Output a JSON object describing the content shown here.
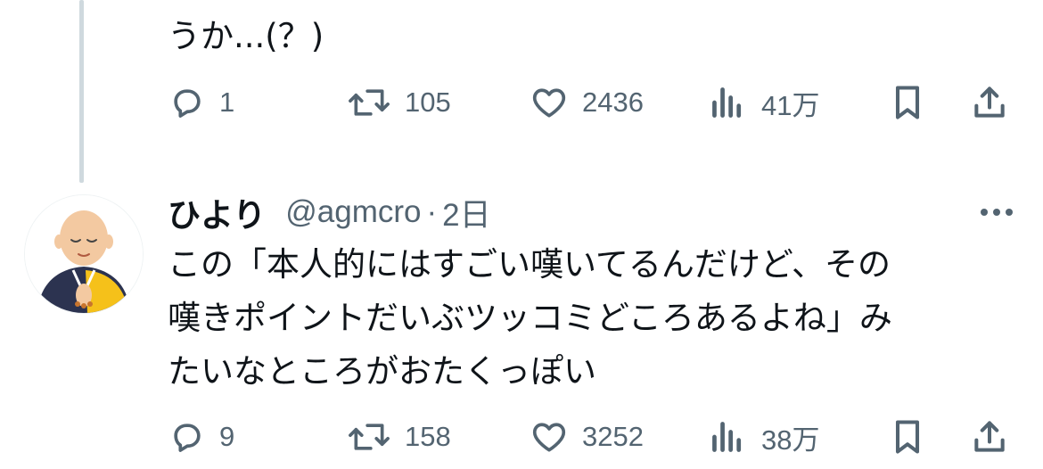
{
  "tweet1": {
    "text_tail": "うか...(？)",
    "actions": {
      "replies": "1",
      "reposts": "105",
      "likes": "2436",
      "views": "41万"
    }
  },
  "tweet2": {
    "author": {
      "display_name": "ひより",
      "handle": "@agmcro",
      "separator": "·",
      "time": "2日"
    },
    "text_lines": [
      "この「本人的にはすごい嘆いてるんだけど、その",
      "嘆きポイントだいぶツッコミどころあるよね」み",
      "たいなところがおたくっぽい"
    ],
    "actions": {
      "replies": "9",
      "reposts": "158",
      "likes": "3252",
      "views": "38万"
    }
  },
  "icons": [
    "reply-icon",
    "repost-icon",
    "like-icon",
    "views-icon",
    "bookmark-icon",
    "share-icon",
    "more-icon"
  ],
  "colors": {
    "text": "#0f1419",
    "secondary": "#536471",
    "thread_line": "#cfd9de",
    "avatar_bg": "#ffffff",
    "robe": "#f5c11a",
    "skin": "#f3c9a1",
    "kimono": "#2c3350"
  }
}
